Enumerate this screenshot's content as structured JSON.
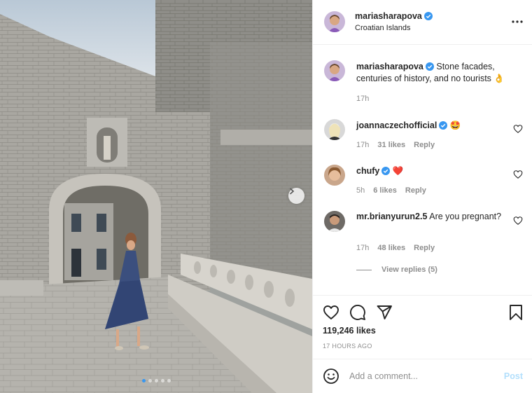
{
  "post": {
    "username": "mariasharapova",
    "location": "Croatian Islands",
    "caption_text": "Stone facades, centuries of history, and no tourists",
    "caption_emoji": "👌",
    "caption_time": "17h",
    "more_icon": "more-horizontal-icon",
    "verified_color": "#3897f0"
  },
  "carousel": {
    "slide_count": 5,
    "current_slide": 1,
    "next_icon": "chevron-right-icon"
  },
  "comments": [
    {
      "username": "joannaczechofficial",
      "verified": true,
      "text": "",
      "emoji": "🤩",
      "time": "17h",
      "likes": "31 likes",
      "reply": "Reply"
    },
    {
      "username": "chufy",
      "verified": true,
      "text": "",
      "emoji": "❤️",
      "time": "5h",
      "likes": "6 likes",
      "reply": "Reply"
    },
    {
      "username": "mr.brianyurun2.5",
      "verified": false,
      "text": "Are you pregnant?",
      "emoji": "",
      "time": "17h",
      "likes": "48 likes",
      "reply": "Reply"
    }
  ],
  "view_replies": "View replies (5)",
  "likes": "119,246 likes",
  "time_ago": "17 HOURS AGO",
  "add_comment": {
    "placeholder": "Add a comment...",
    "post_label": "Post",
    "emoji_icon": "smiley-icon"
  },
  "colors": {
    "accent": "#3897f0",
    "post_disabled": "#b2dffc",
    "muted_text": "#8e8e8e"
  }
}
